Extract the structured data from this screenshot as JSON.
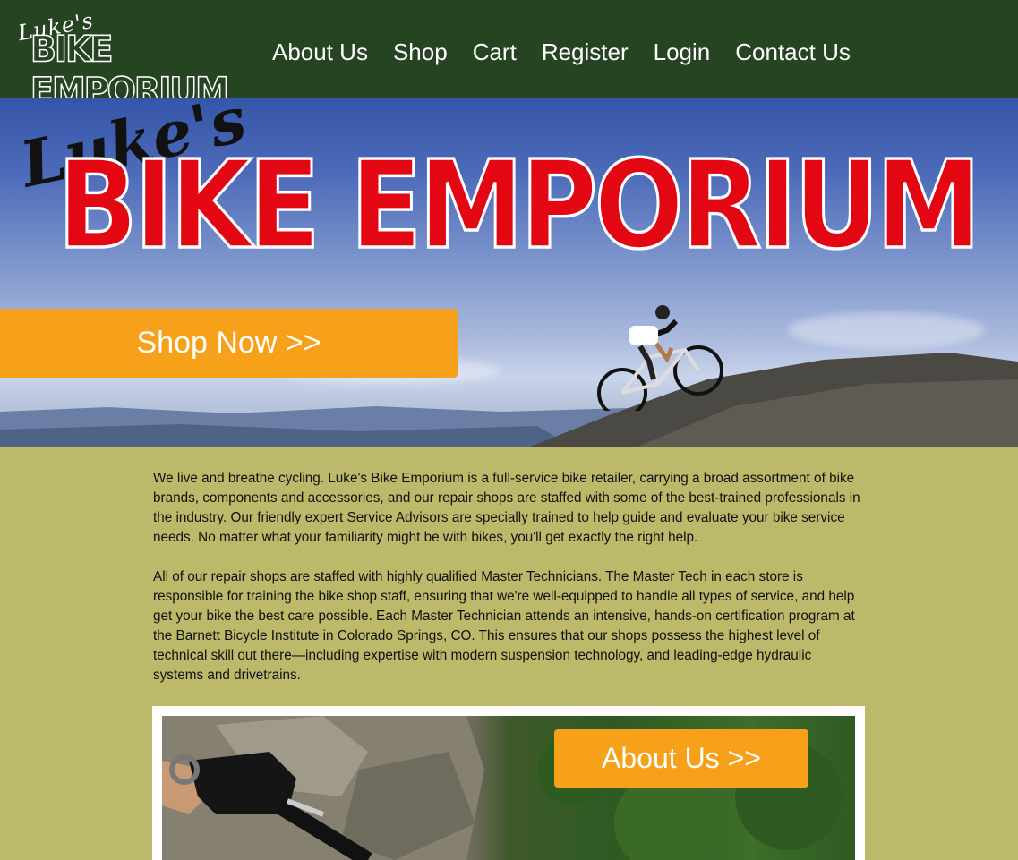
{
  "brand": {
    "script": "Luke's",
    "block": "BIKE EMPORIUM"
  },
  "nav": {
    "items": [
      "About Us",
      "Shop",
      "Cart",
      "Register",
      "Login",
      "Contact Us"
    ]
  },
  "hero": {
    "script": "Luke's",
    "block": "BIKE EMPORIUM",
    "cta": "Shop Now >>"
  },
  "main": {
    "paragraphs": [
      "We live and breathe cycling. Luke's Bike Emporium is a full-service bike retailer, carrying a broad assortment of bike brands, components and accessories, and our repair shops are staffed with some of the best-trained professionals in the industry. Our friendly expert Service Advisors are specially trained to help guide and evaluate your bike service needs. No matter what your familiarity might be with bikes, you'll get exactly the right help.",
      "All of our repair shops are staffed with highly qualified Master Technicians. The Master Tech in each store is responsible for training the bike shop staff, ensuring that we're well-equipped to handle all types of service, and help get your bike the best care possible. Each Master Technician attends an intensive, hands-on certification program at the Barnett Bicycle Institute in Colorado Springs, CO. This ensures that our shops possess the highest level of technical skill out there—including expertise with modern suspension technology, and leading-edge hydraulic systems and drivetrains."
    ],
    "about_cta": "About Us >>"
  },
  "colors": {
    "nav_bg": "#264422",
    "page_bg": "#bdb96a",
    "accent": "#f7a11a",
    "logo_red": "#e30613"
  }
}
